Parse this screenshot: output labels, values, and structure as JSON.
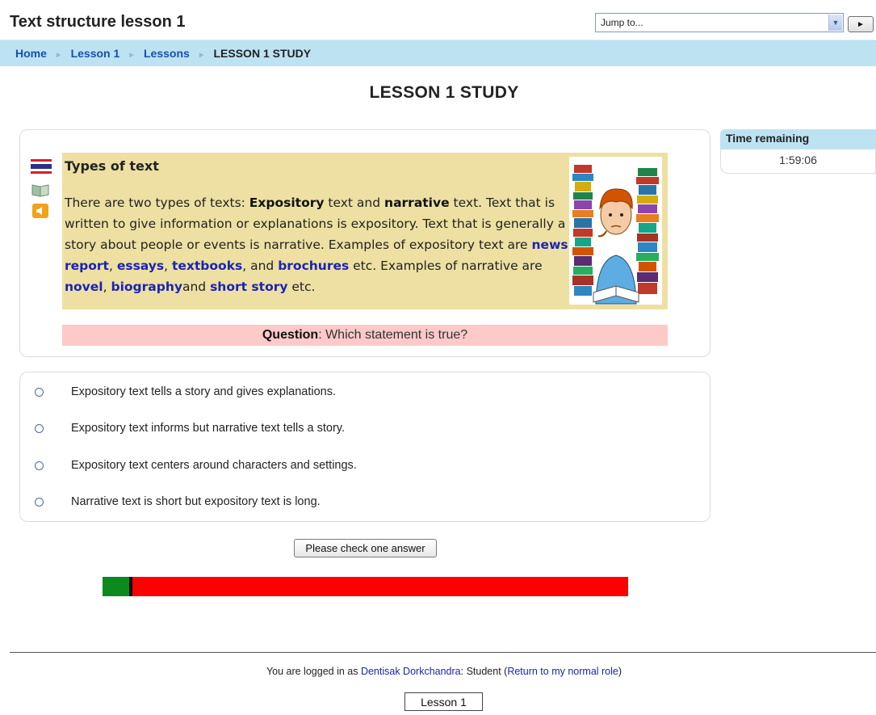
{
  "header": {
    "site_title": "Text structure lesson 1",
    "jump_to": {
      "selected": "Jump to..."
    },
    "go_button": "►"
  },
  "breadcrumb": {
    "items": [
      {
        "label": "Home"
      },
      {
        "label": "Lesson 1"
      },
      {
        "label": "Lessons"
      }
    ],
    "current": "LESSON 1 STUDY"
  },
  "page_title": "LESSON 1 STUDY",
  "lesson_panel": {
    "heading": "Types of text",
    "text": {
      "p1": "There are two types of texts: ",
      "b1": "Expository",
      "p2": " text and ",
      "b2": "narrative",
      "p3": " text. Text that is written to give information or explanations is expository. Text that is generally a story about people or events is narrative. Examples of expository text are ",
      "l1": "news report",
      "c1": ", ",
      "l2": "essays",
      "c2": ", ",
      "l3": "textbooks",
      "c3": ", and ",
      "l4": "brochures",
      "p4": " etc. Examples of narrative are ",
      "l5": "novel",
      "c4": ", ",
      "l6": "biography",
      "p5": "and ",
      "l7": "short story",
      "p6": " etc."
    },
    "side_icons": [
      "thai-flag-icon",
      "book-icon",
      "speaker-icon"
    ]
  },
  "question": {
    "label": "Question",
    "text": ": Which statement is true?"
  },
  "answers": [
    "Expository text tells a story and gives explanations.",
    "Expository text informs but narrative text tells a story.",
    "Expository text centers around characters and settings.",
    "Narrative text is short but expository text is long."
  ],
  "check_button": "Please check one answer",
  "progress": {
    "fraction": 0.05
  },
  "timer": {
    "header": "Time remaining",
    "value": "1:59:06"
  },
  "footer": {
    "login_prefix": "You are logged in as ",
    "user_name": "Dentisak Dorkchandra",
    "role_text": ": Student (",
    "return_link": "Return to my normal role",
    "close_paren": ")",
    "lesson_button": "Lesson 1"
  },
  "colors": {
    "nav_bar": "#bde3f3",
    "lesson_panel": "#ede0a2",
    "question_bar": "#fdc9c9",
    "progress_done": "#0d8a1d",
    "progress_remaining": "#ff0000",
    "link": "#1a24b4"
  }
}
